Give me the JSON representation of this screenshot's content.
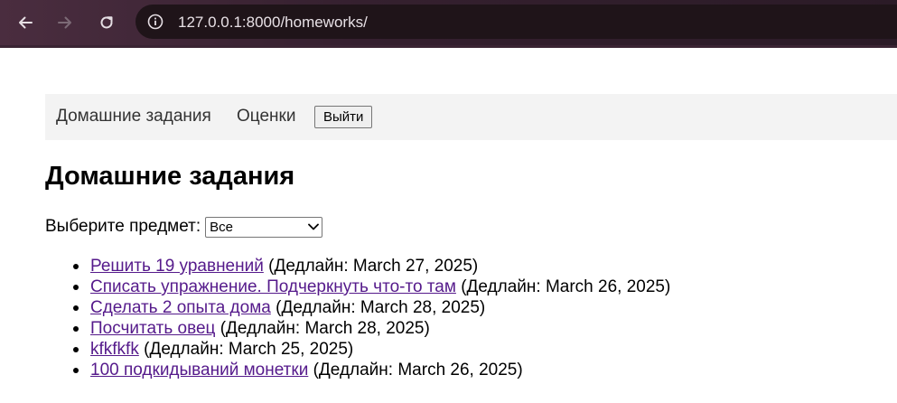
{
  "browser": {
    "url": "127.0.0.1:8000/homeworks/"
  },
  "nav": {
    "homeworks": "Домашние задания",
    "grades": "Оценки",
    "logout": "Выйти"
  },
  "page": {
    "title": "Домашние задания",
    "filter_label": "Выберите предмет:",
    "filter_selected": "Все"
  },
  "homeworks": [
    {
      "title": "Решить 19 уравнений",
      "deadline": "(Дедлайн: March 27, 2025)"
    },
    {
      "title": "Списать упражнение. Подчеркнуть что-то там",
      "deadline": "(Дедлайн: March 26, 2025)"
    },
    {
      "title": "Сделать 2 опыта дома",
      "deadline": "(Дедлайн: March 28, 2025)"
    },
    {
      "title": "Посчитать овец",
      "deadline": "(Дедлайн: March 28, 2025)"
    },
    {
      "title": "kfkfkfk",
      "deadline": "(Дедлайн: March 25, 2025)"
    },
    {
      "title": "100 подкидываний монетки",
      "deadline": "(Дедлайн: March 26, 2025)"
    }
  ],
  "colors": {
    "link_visited": "#551a8b",
    "nav_background": "#f3f3f3",
    "browser_toolbar": "#35202f"
  },
  "icons": {
    "back": "arrow-left-icon",
    "forward": "arrow-right-icon",
    "reload": "reload-icon",
    "site_info": "site-info-icon",
    "select": "chevron-down-icon"
  }
}
